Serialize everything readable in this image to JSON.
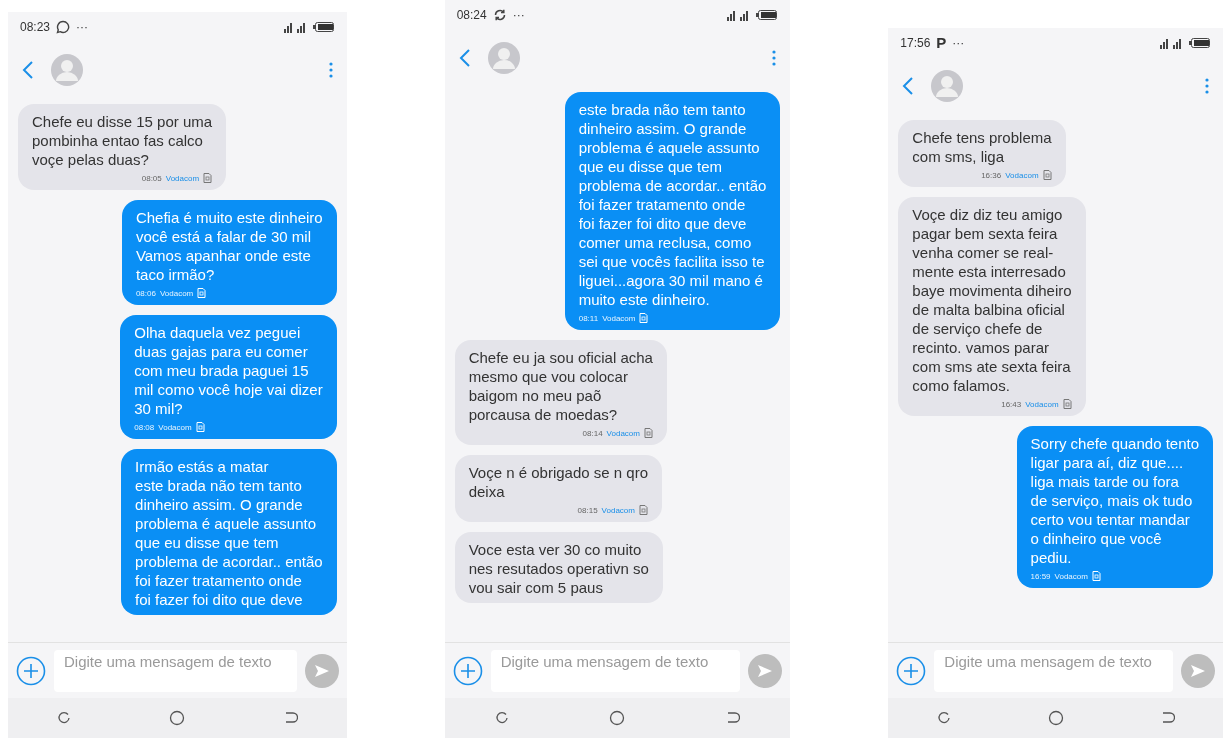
{
  "phones": [
    {
      "status_bar": {
        "time": "08:23",
        "notification": {
          "kind": "chat"
        },
        "more": "···"
      },
      "messages": [
        {
          "kind": "received",
          "text": "Chefe eu disse 15 por uma\npombinha entao fas calco\nvoçe pelas duas?",
          "time": "08:05",
          "carrier": "Vodacom"
        },
        {
          "kind": "sent",
          "text": "Chefia é muito este dinheiro\nvocê está a falar de 30 mil\nVamos apanhar onde este\ntaco irmão?",
          "time": "08:06",
          "carrier": "Vodacom"
        },
        {
          "kind": "sent",
          "text": "Olha daquela vez peguei\nduas gajas para eu comer\ncom meu brada paguei 15\nmil como você hoje vai dizer\n30 mil?",
          "time": "08:08",
          "carrier": "Vodacom"
        },
        {
          "kind": "sent",
          "text": "Irmão estás a matar\neste brada não tem tanto\ndinheiro assim. O grande\nproblema é aquele assunto\nque eu disse que tem\nproblema de acordar.. então\nfoi fazer tratamento onde\nfoi fazer foi dito que deve"
        }
      ],
      "composer": {
        "placeholder": "Digite uma mensagem de texto"
      }
    },
    {
      "status_bar": {
        "time": "08:24",
        "notification": {
          "kind": "sync"
        },
        "more": "···"
      },
      "messages": [
        {
          "kind": "sent",
          "text": "este brada não tem tanto\ndinheiro assim. O grande\nproblema é aquele assunto\nque eu disse que tem\nproblema de acordar.. então\nfoi fazer tratamento onde\nfoi fazer foi dito que deve\ncomer uma reclusa, como\nsei que vocês facilita isso te\nliguei...agora 30 mil mano é\nmuito este dinheiro.",
          "time": "08:11",
          "carrier": "Vodacom"
        },
        {
          "kind": "received",
          "text": "Chefe eu ja sou oficial acha\nmesmo que vou colocar\nbaigom no meu paõ\nporcausa de moedas?",
          "time": "08:14",
          "carrier": "Vodacom"
        },
        {
          "kind": "received",
          "text": "Voçe n é obrigado se n qro\ndeixa",
          "time": "08:15",
          "carrier": "Vodacom"
        },
        {
          "kind": "received",
          "text": "Voce esta ver 30 co muito\nnes resutados operativn so\nvou sair com 5 paus"
        }
      ],
      "composer": {
        "placeholder": "Digite uma mensagem de texto"
      }
    },
    {
      "status_bar": {
        "time": "17:56",
        "notification": {
          "kind": "letter",
          "text": "P"
        },
        "more": "···"
      },
      "messages": [
        {
          "kind": "received",
          "text": "Chefe tens problema\ncom sms, liga",
          "time": "16:36",
          "carrier": "Vodacom"
        },
        {
          "kind": "received",
          "text": "Voçe diz diz teu amigo\npagar bem sexta feira\nvenha comer se real-\nmente esta interresado\nbaye movimenta diheiro\nde malta balbina oficial\nde serviço chefe de\nrecinto. vamos parar\ncom sms ate sexta feira\ncomo falamos.",
          "time": "16:43",
          "carrier": "Vodacom"
        },
        {
          "kind": "sent",
          "text": "Sorry chefe quando tento\nligar para aí, diz que....\n liga mais tarde ou fora\nde serviço, mais ok tudo\ncerto vou tentar mandar\no dinheiro que você\npediu.",
          "time": "16:59",
          "carrier": "Vodacom"
        }
      ],
      "composer": {
        "placeholder": "Digite uma mensagem de texto"
      }
    }
  ]
}
